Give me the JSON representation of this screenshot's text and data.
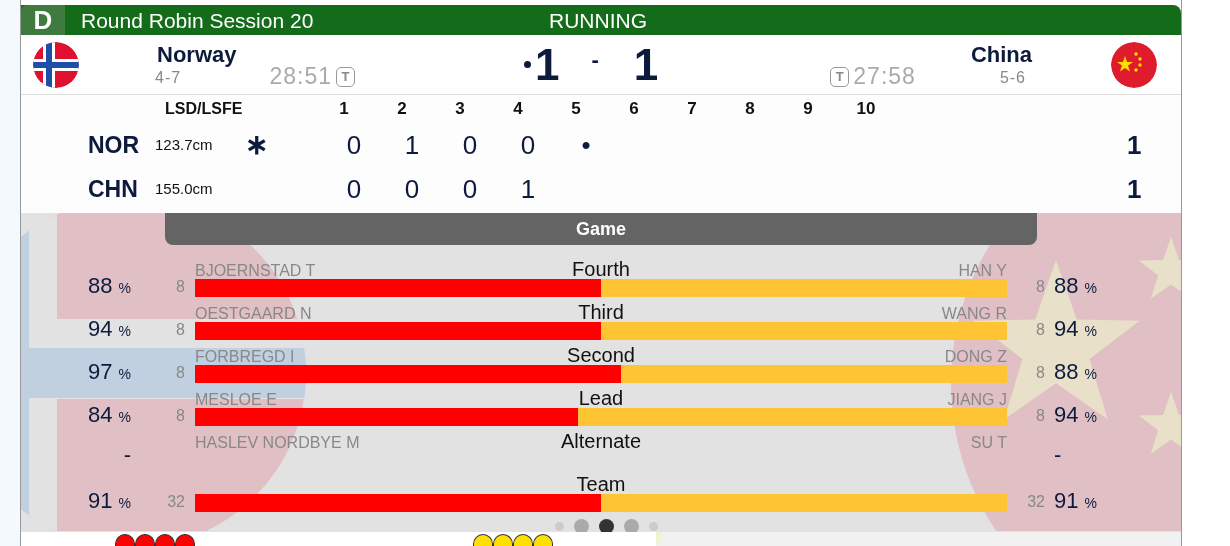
{
  "header": {
    "badge": "D",
    "title": "Round Robin Session 20",
    "status": "RUNNING"
  },
  "teams": [
    {
      "kind": "norway",
      "name": "Norway",
      "record": "4-7",
      "time": "28:51",
      "timeout": "T",
      "hammer": true,
      "score": "1"
    },
    {
      "kind": "china",
      "name": "China",
      "record": "5-6",
      "time": "27:58",
      "timeout": "T",
      "hammer": false,
      "score": "1"
    }
  ],
  "score_separator": "-",
  "linescore": {
    "lsd_heading": "LSD/LSFE",
    "ends": [
      "1",
      "2",
      "3",
      "4",
      "5",
      "6",
      "7",
      "8",
      "9",
      "10"
    ],
    "rows": [
      {
        "code": "NOR",
        "lsd": "123.7cm",
        "marker": "∗",
        "scores": [
          "0",
          "1",
          "0",
          "0",
          "•"
        ],
        "total": "1"
      },
      {
        "code": "CHN",
        "lsd": "155.0cm",
        "marker": "",
        "scores": [
          "0",
          "0",
          "0",
          "1"
        ],
        "total": "1"
      }
    ]
  },
  "tab": "Game",
  "stats": [
    {
      "kind": "bar",
      "position": "Fourth",
      "level": 0.5,
      "left": {
        "name": "BJOERNSTAD T",
        "shots": "8",
        "pct": "88",
        "unit": "%"
      },
      "right": {
        "name": "HAN Y",
        "shots": "8",
        "pct": "88",
        "unit": "%"
      }
    },
    {
      "kind": "bar",
      "position": "Third",
      "level": 0.5,
      "left": {
        "name": "OESTGAARD N",
        "shots": "8",
        "pct": "94",
        "unit": "%"
      },
      "right": {
        "name": "WANG R",
        "shots": "8",
        "pct": "94",
        "unit": "%"
      }
    },
    {
      "kind": "bar",
      "position": "Second",
      "level": 0.525,
      "left": {
        "name": "FORBREGD I",
        "shots": "8",
        "pct": "97",
        "unit": "%"
      },
      "right": {
        "name": "DONG Z",
        "shots": "8",
        "pct": "88",
        "unit": "%"
      }
    },
    {
      "kind": "bar",
      "position": "Lead",
      "level": 0.472,
      "left": {
        "name": "MESLOE E",
        "shots": "8",
        "pct": "84",
        "unit": "%"
      },
      "right": {
        "name": "JIANG J",
        "shots": "8",
        "pct": "94",
        "unit": "%"
      }
    },
    {
      "kind": "empty",
      "position": "Alternate",
      "left": {
        "name": "HASLEV NORDBYE M",
        "pct": "-"
      },
      "right": {
        "name": "SU T",
        "pct": "-"
      }
    },
    {
      "kind": "bar",
      "position": "Team",
      "level": 0.5,
      "left": {
        "shots": "32",
        "pct": "91",
        "unit": "%"
      },
      "right": {
        "shots": "32",
        "pct": "91",
        "unit": "%"
      }
    }
  ],
  "pages": [
    {
      "kind": "small",
      "selected": false
    },
    {
      "kind": "large",
      "selected": false
    },
    {
      "kind": "large",
      "selected": true
    },
    {
      "kind": "large",
      "selected": false
    },
    {
      "kind": "small",
      "selected": false
    }
  ],
  "stones": {
    "left": [
      {
        "color": "#ff0000"
      },
      {
        "color": "#ff0000"
      },
      {
        "color": "#ff0000"
      },
      {
        "color": "#ff0000"
      }
    ],
    "right": [
      {
        "color": "#ffe000"
      },
      {
        "color": "#ffe000"
      },
      {
        "color": "#ffe000"
      },
      {
        "color": "#ffe000"
      }
    ]
  }
}
